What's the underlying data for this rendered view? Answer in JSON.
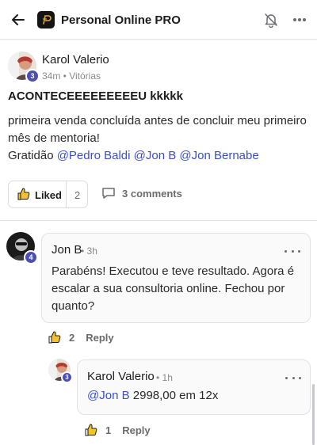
{
  "app": {
    "title": "Personal Online PRO"
  },
  "post": {
    "author": "Karol Valerio",
    "level": "3",
    "time": "34m",
    "category": "Vitórias",
    "headline": "ACONTECEEEEEEEEEU kkkkk",
    "body_line1": "primeira venda concluída antes de concluir meu primeiro",
    "body_line2": "mês de mentoria!",
    "body_prefix": "Gratidão ",
    "mentions": [
      "@Pedro Baldi",
      "@Jon B",
      "@Jon Bernabe"
    ],
    "liked_label": "Liked",
    "like_count": "2",
    "comments_label": "3 comments"
  },
  "comments": [
    {
      "author": "Jon B",
      "level": "4",
      "time": "3h",
      "text": "Parabéns! Executou e teve resultado. Agora é escalar a sua consultoria online. Fechou por quanto?",
      "like_count": "2",
      "reply_label": "Reply"
    },
    {
      "author": "Karol Valerio",
      "level": "3",
      "time": "1h",
      "mention": "@Jon B",
      "text": " 2998,00 em 12x",
      "like_count": "1",
      "reply_label": "Reply"
    }
  ],
  "icons": {
    "back": "arrow-left-icon",
    "logo": "app-logo-icon",
    "bell": "bell-off-icon",
    "more": "more-vertical-icon",
    "thumb": "thumbs-up-icon",
    "comment": "comment-icon"
  },
  "colors": {
    "mention": "#3a4fcf",
    "level_badge": "#4b4fb3",
    "text": "#1c1c1e",
    "muted": "#8a8a8e"
  }
}
